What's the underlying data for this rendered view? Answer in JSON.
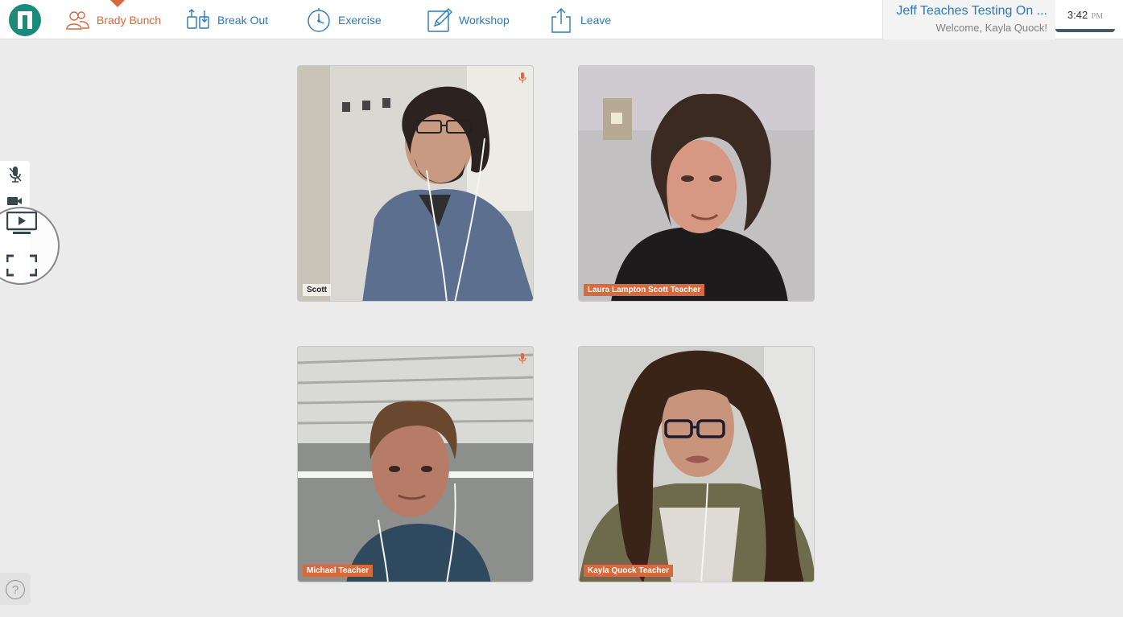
{
  "nav": {
    "items": [
      {
        "label": "Brady Bunch",
        "icon": "people-icon",
        "active": true
      },
      {
        "label": "Break Out",
        "icon": "breakout-icon",
        "active": false
      },
      {
        "label": "Exercise",
        "icon": "stopwatch-icon",
        "active": false
      },
      {
        "label": "Workshop",
        "icon": "pencil-icon",
        "active": false
      },
      {
        "label": "Leave",
        "icon": "share-out-icon",
        "active": false
      }
    ]
  },
  "session": {
    "title": "Jeff Teaches Testing On ...",
    "welcome": "Welcome, Kayla Quock!"
  },
  "clock": {
    "time": "3:42",
    "ampm": "PM"
  },
  "sidebar": {
    "buttons": [
      "microphone-icon",
      "camera-icon",
      "screen-share-icon",
      "fullscreen-icon"
    ]
  },
  "help": {
    "icon": "help-icon"
  },
  "participants": [
    {
      "name": "Scott",
      "muted": true
    },
    {
      "name": "Laura Lampton Scott Teacher",
      "muted": false
    },
    {
      "name": "Michael Teacher",
      "muted": true
    },
    {
      "name": "Kayla Quock Teacher",
      "muted": false
    }
  ],
  "colors": {
    "accent": "#d4693a",
    "link": "#2b7bb9",
    "brand": "#1b8a7a",
    "background": "#ebebeb"
  }
}
